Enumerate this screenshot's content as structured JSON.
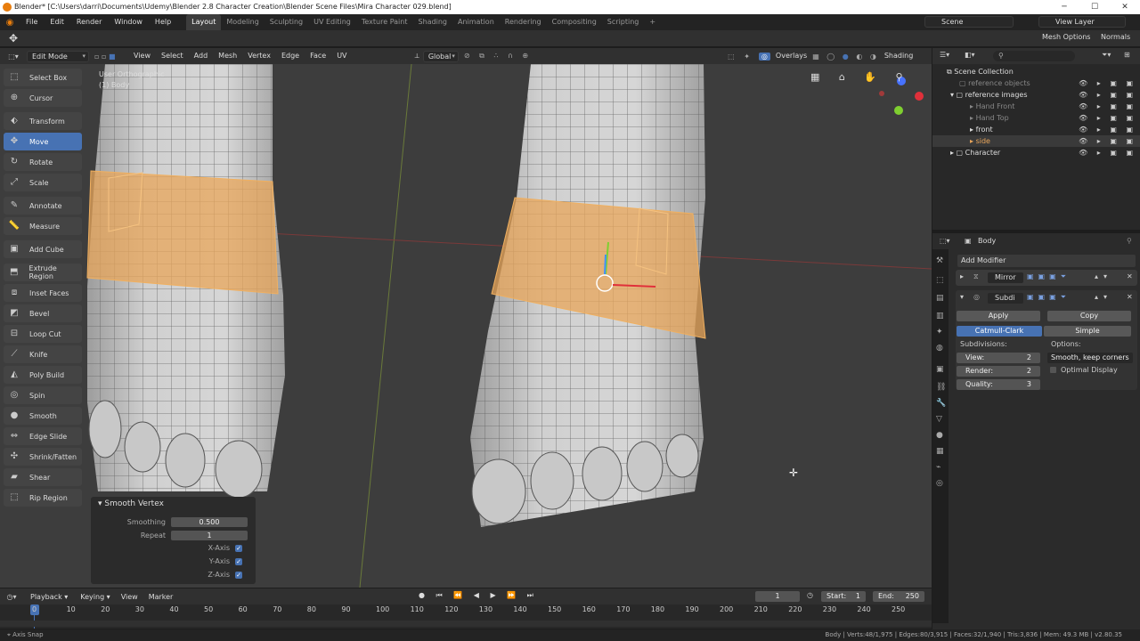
{
  "window": {
    "title": "Blender* [C:\\Users\\darri\\Documents\\Udemy\\Blender 2.8 Character Creation\\Blender Scene Files\\Mira Character 029.blend]",
    "minimize": "─",
    "maximize": "☐",
    "close": "✕"
  },
  "menu": [
    "File",
    "Edit",
    "Render",
    "Window",
    "Help"
  ],
  "workspaces": [
    "Layout",
    "Modeling",
    "Sculpting",
    "UV Editing",
    "Texture Paint",
    "Shading",
    "Animation",
    "Rendering",
    "Compositing",
    "Scripting",
    "+"
  ],
  "scene": "Scene",
  "view_layer": "View Layer",
  "top_right": {
    "mesh_options": "Mesh Options",
    "normals": "Normals"
  },
  "viewport_header": {
    "mode": "Edit Mode",
    "menus": [
      "View",
      "Select",
      "Add",
      "Mesh",
      "Vertex",
      "Edge",
      "Face",
      "UV"
    ],
    "orientation": "Global",
    "overlays": "Overlays",
    "shading": "Shading"
  },
  "viewport_info": {
    "view": "User Orthographic",
    "object": "(1) Body"
  },
  "tools": [
    "Select Box",
    "Cursor",
    "Transform",
    "Move",
    "Rotate",
    "Scale",
    "Annotate",
    "Measure",
    "Add Cube",
    "Extrude Region",
    "Inset Faces",
    "Bevel",
    "Loop Cut",
    "Knife",
    "Poly Build",
    "Spin",
    "Smooth",
    "Edge Slide",
    "Shrink/Fatten",
    "Shear",
    "Rip Region"
  ],
  "active_tool": "Move",
  "operator_panel": {
    "title": "Smooth Vertex",
    "smoothing_label": "Smoothing",
    "smoothing": "0.500",
    "repeat_label": "Repeat",
    "repeat": "1",
    "x_axis": "X-Axis",
    "y_axis": "Y-Axis",
    "z_axis": "Z-Axis",
    "check": "✓"
  },
  "outliner": {
    "root": "Scene Collection",
    "items": [
      {
        "name": "reference objects",
        "indent": 1,
        "dim": true
      },
      {
        "name": "reference images",
        "indent": 1,
        "dim": false
      },
      {
        "name": "Hand Front",
        "indent": 2,
        "dim": true
      },
      {
        "name": "Hand Top",
        "indent": 2,
        "dim": true
      },
      {
        "name": "front",
        "indent": 2,
        "dim": false
      },
      {
        "name": "side",
        "indent": 2,
        "dim": false,
        "selected": true
      },
      {
        "name": "Character",
        "indent": 1,
        "dim": false
      }
    ],
    "vis_icons": "👁 ▸ ▣ ▣"
  },
  "properties": {
    "object": "Body",
    "add_modifier": "Add Modifier",
    "modifiers": [
      "Mirror",
      "Subdi"
    ],
    "apply": "Apply",
    "copy": "Copy",
    "catmull": "Catmull-Clark",
    "simple": "Simple",
    "subdivisions": "Subdivisions:",
    "options": "Options:",
    "view_label": "View:",
    "view_val": "2",
    "render_label": "Render:",
    "render_val": "2",
    "quality_label": "Quality:",
    "quality_val": "3",
    "uv_smooth": "Smooth, keep corners",
    "optimal_display": "Optimal Display"
  },
  "timeline": {
    "menus": [
      "Playback",
      "Keying",
      "View",
      "Marker"
    ],
    "current": "1",
    "start_label": "Start:",
    "start": "1",
    "end_label": "End:",
    "end": "250",
    "ticks": [
      "0",
      "10",
      "20",
      "30",
      "40",
      "50",
      "60",
      "70",
      "80",
      "90",
      "100",
      "110",
      "120",
      "130",
      "140",
      "150",
      "160",
      "170",
      "180",
      "190",
      "200",
      "210",
      "220",
      "230",
      "240",
      "250"
    ]
  },
  "status": {
    "left": "Axis Snap",
    "right": "Body | Verts:48/1,975 | Edges:80/3,915 | Faces:32/1,940 | Tris:3,836 | Mem: 49.3 MB | v2.80.35"
  },
  "colors": {
    "accent": "#4772b3",
    "selection": "#e89a3c",
    "skin": "#c9c9c9"
  }
}
